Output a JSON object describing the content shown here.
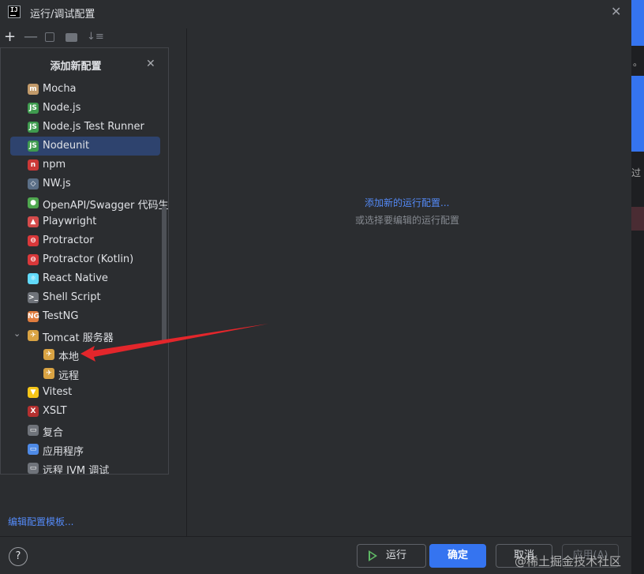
{
  "window": {
    "title": "运行/调试配置",
    "logo_text": "IJ"
  },
  "background": {
    "text1": "。",
    "text2": "过"
  },
  "popup": {
    "title": "添加新配置",
    "items": [
      {
        "label": "Mocha",
        "icon": "mocha-icon",
        "color": "#c29a6a",
        "glyph": "m"
      },
      {
        "label": "Node.js",
        "icon": "nodejs-icon",
        "color": "#3f9b4f",
        "glyph": "JS"
      },
      {
        "label": "Node.js Test Runner",
        "icon": "nodejs-test-icon",
        "color": "#3f9b4f",
        "glyph": "JS"
      },
      {
        "label": "Nodeunit",
        "icon": "nodeunit-icon",
        "color": "#3f9b4f",
        "glyph": "JS"
      },
      {
        "label": "npm",
        "icon": "npm-icon",
        "color": "#cb3837",
        "glyph": "n"
      },
      {
        "label": "NW.js",
        "icon": "nwjs-icon",
        "color": "#5b6f87",
        "glyph": "◇"
      },
      {
        "label": "OpenAPI/Swagger 代码生成",
        "icon": "openapi-icon",
        "color": "#4fa74f",
        "glyph": "●"
      },
      {
        "label": "Playwright",
        "icon": "playwright-icon",
        "color": "#d44b4b",
        "glyph": "▲"
      },
      {
        "label": "Protractor",
        "icon": "protractor-icon",
        "color": "#d9383a",
        "glyph": "⊖"
      },
      {
        "label": "Protractor (Kotlin)",
        "icon": "protractor-kotlin-icon",
        "color": "#d9383a",
        "glyph": "⊖"
      },
      {
        "label": "React Native",
        "icon": "react-icon",
        "color": "#61dafb",
        "glyph": "⚛"
      },
      {
        "label": "Shell Script",
        "icon": "terminal-icon",
        "color": "#6f737a",
        "glyph": ">_"
      },
      {
        "label": "TestNG",
        "icon": "testng-icon",
        "color": "#e07c3e",
        "glyph": "NG"
      },
      {
        "label": "Tomcat 服务器",
        "icon": "tomcat-icon",
        "color": "#d9a343",
        "glyph": "✈"
      },
      {
        "label": "本地",
        "icon": "tomcat-local-icon",
        "color": "#d9a343",
        "glyph": "✈"
      },
      {
        "label": "远程",
        "icon": "tomcat-remote-icon",
        "color": "#d9a343",
        "glyph": "✈"
      },
      {
        "label": "Vitest",
        "icon": "vitest-icon",
        "color": "#f5c518",
        "glyph": "▼"
      },
      {
        "label": "XSLT",
        "icon": "xslt-icon",
        "color": "#b43030",
        "glyph": "X"
      },
      {
        "label": "复合",
        "icon": "compound-icon",
        "color": "#6f737a",
        "glyph": "▭"
      },
      {
        "label": "应用程序",
        "icon": "application-icon",
        "color": "#4e8ae6",
        "glyph": "▭"
      },
      {
        "label": "远程 JVM 调试",
        "icon": "remote-jvm-icon",
        "color": "#6f737a",
        "glyph": "▭"
      }
    ],
    "selected_index": 3
  },
  "main": {
    "add_link": "添加新的运行配置...",
    "subtitle": "或选择要编辑的运行配置"
  },
  "footer": {
    "edit_templates": "编辑配置模板...",
    "help": "?",
    "run": "运行",
    "ok": "确定",
    "cancel": "取消",
    "apply": "应用(A)",
    "watermark": "@稀土掘金技术社区"
  }
}
